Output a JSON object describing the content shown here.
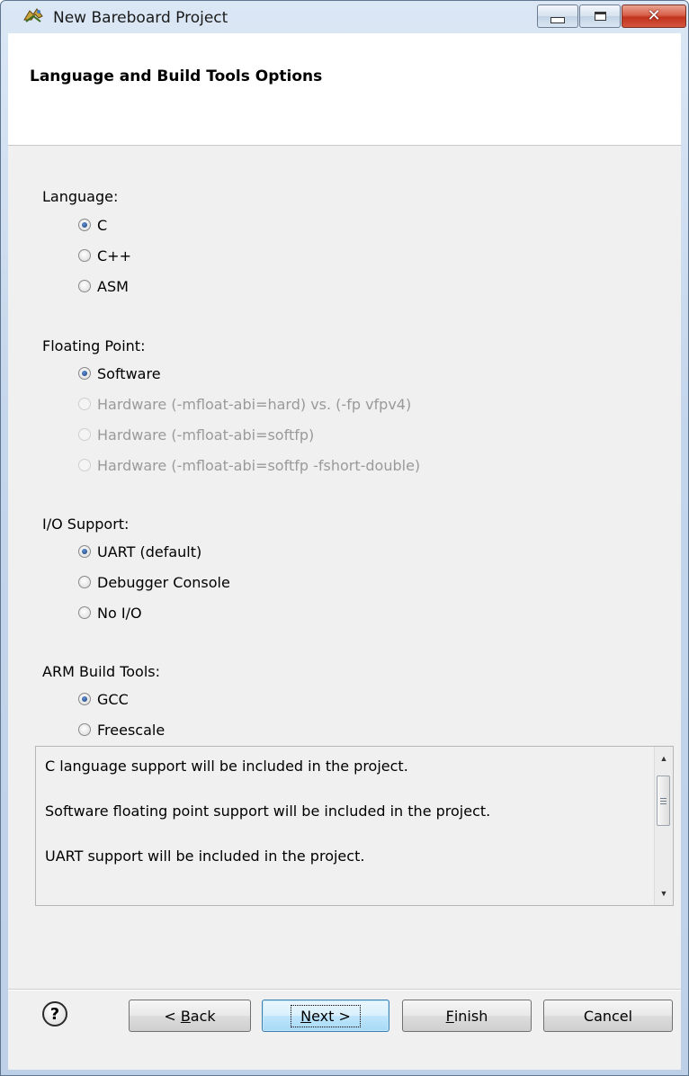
{
  "window": {
    "title": "New Bareboard Project"
  },
  "banner": {
    "title": "Language and Build Tools Options"
  },
  "groups": {
    "language": {
      "label": "Language:",
      "options": [
        {
          "label": "C",
          "checked": true,
          "enabled": true
        },
        {
          "label": "C++",
          "checked": false,
          "enabled": true
        },
        {
          "label": "ASM",
          "checked": false,
          "enabled": true
        }
      ]
    },
    "floating_point": {
      "label": "Floating Point:",
      "options": [
        {
          "label": "Software",
          "checked": true,
          "enabled": true
        },
        {
          "label": "Hardware (-mfloat-abi=hard) vs. (-fp vfpv4)",
          "checked": false,
          "enabled": false
        },
        {
          "label": "Hardware (-mfloat-abi=softfp)",
          "checked": false,
          "enabled": false
        },
        {
          "label": "Hardware (-mfloat-abi=softfp -fshort-double)",
          "checked": false,
          "enabled": false
        }
      ]
    },
    "io_support": {
      "label": "I/O Support:",
      "options": [
        {
          "label": "UART (default)",
          "checked": true,
          "enabled": true
        },
        {
          "label": "Debugger Console",
          "checked": false,
          "enabled": true
        },
        {
          "label": "No I/O",
          "checked": false,
          "enabled": true
        }
      ]
    },
    "build_tools": {
      "label": "ARM Build Tools:",
      "options": [
        {
          "label": "GCC",
          "checked": true,
          "enabled": true
        },
        {
          "label": "Freescale",
          "checked": false,
          "enabled": true
        }
      ]
    }
  },
  "description": {
    "lines": [
      "C language support will be included in the project.",
      "Software floating point support will be included in the project.",
      "UART support will be included in the project."
    ]
  },
  "buttons": {
    "help_glyph": "?",
    "back": {
      "prefix": "< ",
      "mnemonic": "B",
      "rest": "ack"
    },
    "next": {
      "prefix": "",
      "mnemonic": "N",
      "rest": "ext >"
    },
    "finish": {
      "prefix": "",
      "mnemonic": "F",
      "rest": "inish"
    },
    "cancel": "Cancel"
  },
  "icons": {
    "app": "eclipse-project-icon",
    "help": "help-icon",
    "minimize": "minimize-icon",
    "maximize": "maximize-icon",
    "close": "close-icon"
  },
  "colors": {
    "client_bg": "#f0f0f0",
    "title_bar": "#c4d6ec",
    "close_button": "#c1341e",
    "default_button": "#bee6fd"
  }
}
